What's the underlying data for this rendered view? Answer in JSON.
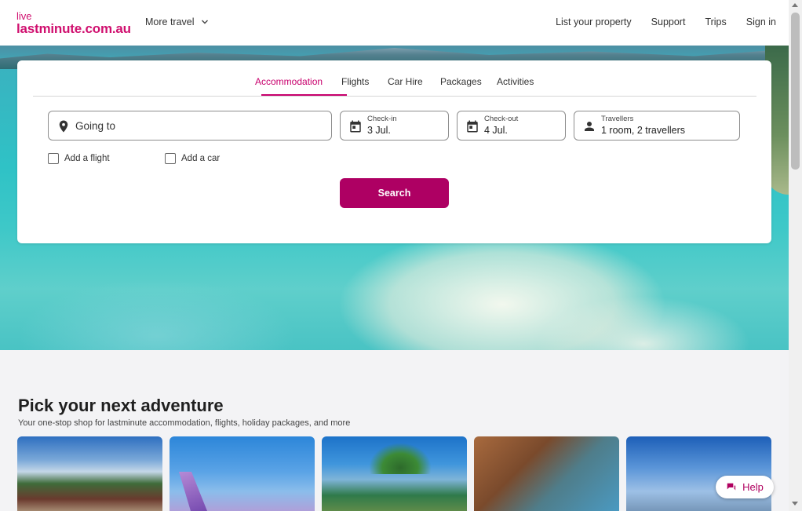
{
  "header": {
    "logo_top": "live",
    "logo_main": "lastminute.com.au",
    "more_travel": "More travel",
    "nav": [
      "List your property",
      "Support",
      "Trips",
      "Sign in"
    ]
  },
  "search": {
    "tabs": [
      "Accommodation",
      "Flights",
      "Car Hire",
      "Packages",
      "Activities"
    ],
    "active_tab": "Accommodation",
    "destination_placeholder": "Going to",
    "checkin_label": "Check-in",
    "checkin_value": "3 Jul.",
    "checkout_label": "Check-out",
    "checkout_value": "4 Jul.",
    "travellers_label": "Travellers",
    "travellers_value": "1 room, 2 travellers",
    "add_flight": "Add a flight",
    "add_car": "Add a car",
    "search_label": "Search"
  },
  "content": {
    "title": "Pick your next adventure",
    "subtitle": "Your one-stop shop for lastminute accommodation, flights, holiday packages, and more"
  },
  "help_label": "Help",
  "colors": {
    "brand": "#d0106f",
    "search_button": "#ae0063"
  },
  "icons": [
    "location-pin-icon",
    "calendar-icon",
    "person-icon",
    "chevron-down-icon",
    "chat-icon"
  ]
}
